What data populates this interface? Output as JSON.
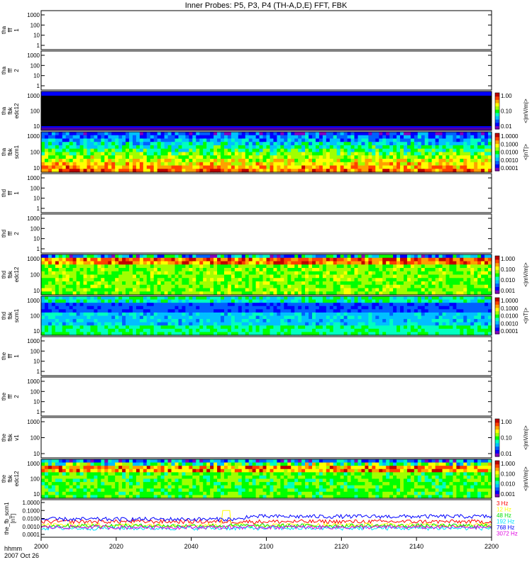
{
  "title": "Inner Probes: P5, P3, P4 (TH-A,D,E) FFT, FBK",
  "colors": {
    "frame": "#000000",
    "spectrogram_scale": [
      "#8000c0",
      "#0000ff",
      "#0060ff",
      "#00c0ff",
      "#00ffc0",
      "#00ff00",
      "#a0ff00",
      "#ffff00",
      "#ffa000",
      "#ff4000",
      "#c00000"
    ]
  },
  "chart_data": [
    {
      "type": "heatmap",
      "panel": "tha_fff_1",
      "ylabel": [
        "tha",
        "fff",
        "1"
      ],
      "yticks": [
        "1000",
        "100",
        "10",
        "1"
      ],
      "empty": true
    },
    {
      "type": "heatmap",
      "panel": "tha_fff_2",
      "ylabel": [
        "tha",
        "fff",
        "2"
      ],
      "yticks": [
        "1000",
        "100",
        "10",
        "1"
      ],
      "empty": true
    },
    {
      "type": "heatmap",
      "panel": "tha_fbk_edc12",
      "ylabel": [
        "tha",
        "fbk",
        "edc12"
      ],
      "yticks": [
        "1000",
        "100",
        "10"
      ],
      "colorbar": {
        "ticks": [
          "1.00",
          "0.10",
          "0.01"
        ],
        "unit": "<|mV/m|>"
      },
      "pattern": "saturated-black"
    },
    {
      "type": "heatmap",
      "panel": "tha_fbk_scm1",
      "ylabel": [
        "tha",
        "fbk",
        "scm1"
      ],
      "yticks": [
        "1000",
        "100",
        "10"
      ],
      "colorbar": {
        "ticks": [
          "1.0000",
          "0.1000",
          "0.0100",
          "0.0010",
          "0.0001"
        ],
        "unit": "<|nT|>"
      },
      "pattern": "scm-a"
    },
    {
      "type": "heatmap",
      "panel": "thd_fff_1",
      "ylabel": [
        "thd",
        "fff",
        "1"
      ],
      "yticks": [
        "1000",
        "100",
        "10",
        "1"
      ],
      "empty": true
    },
    {
      "type": "heatmap",
      "panel": "thd_fff_2",
      "ylabel": [
        "thd",
        "fff",
        "2"
      ],
      "yticks": [
        "1000",
        "100",
        "10",
        "1"
      ],
      "empty": true
    },
    {
      "type": "heatmap",
      "panel": "thd_fbk_edc12",
      "ylabel": [
        "thd",
        "fbk",
        "edc12"
      ],
      "yticks": [
        "1000",
        "100",
        "10"
      ],
      "colorbar": {
        "ticks": [
          "1.000",
          "0.100",
          "0.010",
          "0.001"
        ],
        "unit": "<|mV/m|>"
      },
      "pattern": "edc-d"
    },
    {
      "type": "heatmap",
      "panel": "thd_fbk_scm1",
      "ylabel": [
        "thd",
        "fbk",
        "scm1"
      ],
      "yticks": [
        "1000",
        "100",
        "10"
      ],
      "colorbar": {
        "ticks": [
          "1.0000",
          "0.1000",
          "0.0100",
          "0.0010",
          "0.0001"
        ],
        "unit": "<|nT|>"
      },
      "pattern": "scm-d"
    },
    {
      "type": "heatmap",
      "panel": "the_fff_1",
      "ylabel": [
        "the",
        "fff",
        "1"
      ],
      "yticks": [
        "1000",
        "100",
        "10",
        "1"
      ],
      "empty": true
    },
    {
      "type": "heatmap",
      "panel": "the_fff_2",
      "ylabel": [
        "the",
        "fff",
        "2"
      ],
      "yticks": [
        "1000",
        "100",
        "10",
        "1"
      ],
      "empty": true
    },
    {
      "type": "heatmap",
      "panel": "the_fbk_v1",
      "ylabel": [
        "the",
        "fbk",
        "v1"
      ],
      "yticks": [
        "1000",
        "100",
        "10"
      ],
      "colorbar": {
        "ticks": [
          "1.00",
          "0.10",
          "0.01"
        ],
        "unit": "<|mV/m|>"
      },
      "empty": true
    },
    {
      "type": "heatmap",
      "panel": "the_fbk_edc12",
      "ylabel": [
        "the",
        "fbk",
        "edc12"
      ],
      "yticks": [
        "1000",
        "100",
        "10"
      ],
      "colorbar": {
        "ticks": [
          "1.000",
          "0.100",
          "0.010",
          "0.001"
        ],
        "unit": "<|mV/m|>"
      },
      "pattern": "edc-e"
    },
    {
      "type": "line",
      "panel": "the_fb_scm1",
      "ylabel": [
        "the_fb_scm1",
        "[nT]"
      ],
      "yticks": [
        "1.0000",
        "0.1000",
        "0.0100",
        "0.0010",
        "0.0001"
      ],
      "ylim": [
        0.0001,
        1.0
      ],
      "yscale": "log",
      "series": [
        {
          "name": "3 Hz",
          "color": "#ff0000",
          "level": 0.004
        },
        {
          "name": "12 Hz",
          "color": "#ffff00",
          "level": 0.0015
        },
        {
          "name": "48 Hz",
          "color": "#00e000",
          "level": 0.0012
        },
        {
          "name": "192 Hz",
          "color": "#00e0ff",
          "level": 0.0006
        },
        {
          "name": "768 Hz",
          "color": "#0000ff",
          "level": 0.008
        },
        {
          "name": "3072 Hz",
          "color": "#e000e0",
          "level": 0.0008
        }
      ]
    }
  ],
  "time_axis": {
    "row1_label": "hhmm",
    "row2_label": "2007 Oct 26",
    "ticks": [
      "2000",
      "2020",
      "2040",
      "2100",
      "2120",
      "2140",
      "2200"
    ]
  }
}
